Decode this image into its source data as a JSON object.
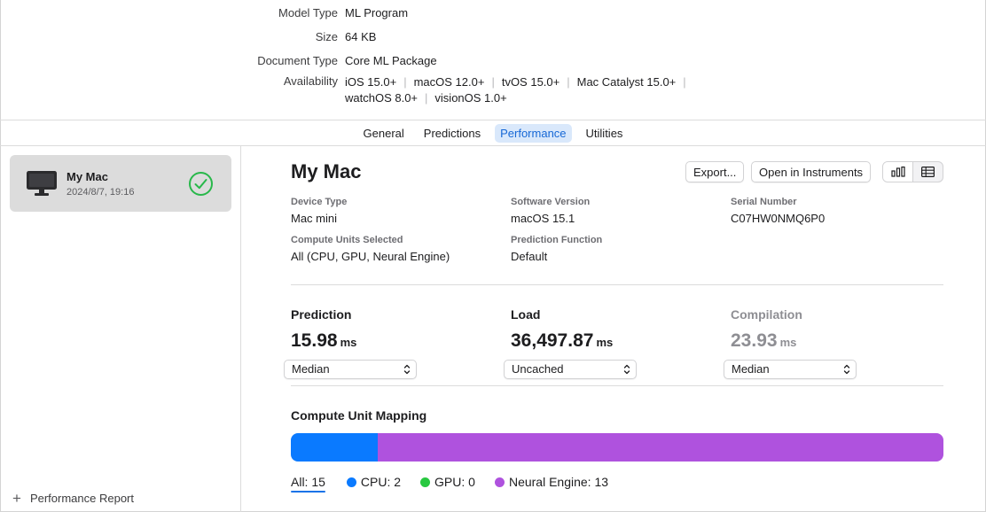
{
  "metadata": {
    "model_type_key": "Model Type",
    "model_type_val": "ML Program",
    "size_key": "Size",
    "size_val": "64 KB",
    "doc_type_key": "Document Type",
    "doc_type_val": "Core ML Package",
    "availability_key": "Availability",
    "availability": [
      "iOS 15.0+",
      "macOS 12.0+",
      "tvOS 15.0+",
      "Mac Catalyst 15.0+",
      "watchOS 8.0+",
      "visionOS 1.0+"
    ]
  },
  "tabs": [
    {
      "label": "General"
    },
    {
      "label": "Predictions"
    },
    {
      "label": "Performance"
    },
    {
      "label": "Utilities"
    }
  ],
  "sidebar": {
    "device_name": "My Mac",
    "device_date": "2024/8/7, 19:16",
    "report_label": "Performance Report"
  },
  "main": {
    "title": "My Mac",
    "export_label": "Export...",
    "instruments_label": "Open in Instruments",
    "info": {
      "device_type_label": "Device Type",
      "device_type": "Mac mini",
      "software_version_label": "Software Version",
      "software_version": "macOS 15.1",
      "serial_label": "Serial Number",
      "serial": "C07HW0NMQ6P0",
      "compute_units_label": "Compute Units Selected",
      "compute_units": "All (CPU, GPU, Neural Engine)",
      "prediction_function_label": "Prediction Function",
      "prediction_function": "Default"
    },
    "metrics": {
      "prediction_label": "Prediction",
      "prediction_value": "15.98",
      "prediction_select": "Median",
      "load_label": "Load",
      "load_value": "36,497.87",
      "load_select": "Uncached",
      "compilation_label": "Compilation",
      "compilation_value": "23.93",
      "compilation_select": "Median",
      "unit": "ms"
    },
    "mapping": {
      "title": "Compute Unit Mapping",
      "all_label": "All: 15",
      "cpu_label": "CPU: 2",
      "gpu_label": "GPU: 0",
      "ne_label": "Neural Engine: 13",
      "cpu_count": 2,
      "gpu_count": 0,
      "ne_count": 13,
      "total": 15
    }
  },
  "colors": {
    "cpu": "#0a7aff",
    "gpu": "#28c840",
    "neural_engine": "#af52de",
    "tab_active_bg": "#d9e8fb",
    "tab_active_fg": "#1668d6",
    "check": "#28b84a"
  },
  "icons": {
    "device": "mac-mini-display-icon",
    "status": "checkmark-circle-icon",
    "chart_view": "bar-chart-icon",
    "table_view": "table-icon",
    "add": "plus-icon",
    "select": "chevron-up-down-icon"
  }
}
